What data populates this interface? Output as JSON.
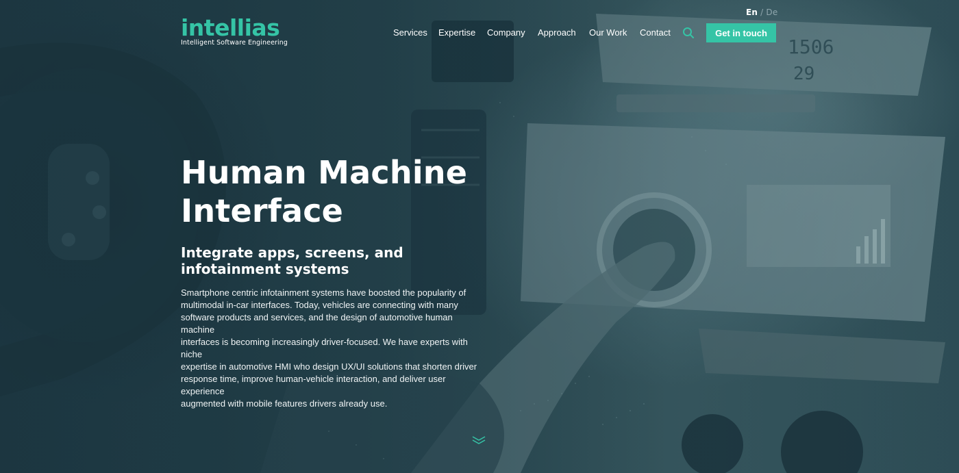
{
  "header": {
    "logo": {
      "wordmark": "intellias",
      "tagline": "Intelligent Software Engineering"
    },
    "language": {
      "active": "En",
      "separator": "/",
      "inactive": "De"
    },
    "nav": [
      {
        "label": "Services"
      },
      {
        "label": "Expertise"
      },
      {
        "label": "Company"
      },
      {
        "label": "Approach"
      },
      {
        "label": "Our Work"
      },
      {
        "label": "Contact"
      }
    ],
    "search_icon": "search-icon",
    "cta_label": "Get in touch"
  },
  "hero": {
    "title_line1": "Human Machine",
    "title_line2": "Interface",
    "subtitle_line1": "Integrate apps, screens, and",
    "subtitle_line2": "infotainment systems",
    "body_lines": [
      "Smartphone centric infotainment systems have boosted the popularity of",
      "multimodal in-car interfaces. Today, vehicles are connecting with many",
      "software products and services, and the design of automotive human machine",
      "interfaces is becoming increasingly driver-focused. We have experts with niche",
      "expertise in automotive HMI who design UX/UI solutions that shorten driver",
      "response time, improve human-vehicle interaction, and deliver user experience",
      "augmented with mobile features drivers already use."
    ],
    "scroll_icon": "chevron-double-down-icon",
    "dashboard_display": {
      "time": "1506",
      "temperature": "29"
    }
  },
  "colors": {
    "accent": "#35c4a6",
    "background": "#22414c",
    "text": "#ffffff"
  }
}
